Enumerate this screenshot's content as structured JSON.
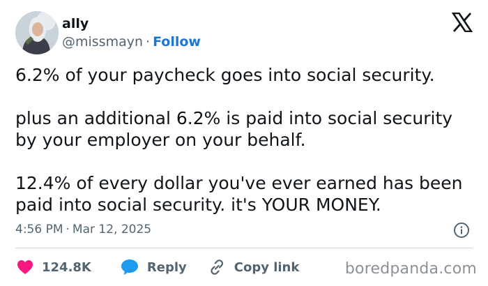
{
  "author": {
    "name": "ally",
    "handle": "@missmayn",
    "separator": "·",
    "follow_label": "Follow"
  },
  "tweet": {
    "paragraphs": [
      "6.2% of your paycheck goes into social security.",
      "plus an additional 6.2% is paid into social security by your employer on your behalf.",
      "12.4% of every dollar you've ever earned has been paid into social security. it's YOUR MONEY."
    ],
    "time": "4:56 PM",
    "separator": "·",
    "date": "Mar 12, 2025"
  },
  "actions": {
    "likes_count": "124.8K",
    "reply_label": "Reply",
    "copy_link_label": "Copy link"
  },
  "icons": {
    "platform": "x-logo-icon",
    "info": "info-icon",
    "like": "heart-icon",
    "reply": "speech-bubble-icon",
    "copy": "link-icon"
  },
  "colors": {
    "text": "#0f1419",
    "muted": "#536471",
    "follow": "#1d76d2",
    "heart": "#f91880",
    "reply_bubble": "#1d9bf0"
  },
  "watermark": "boredpanda.com"
}
